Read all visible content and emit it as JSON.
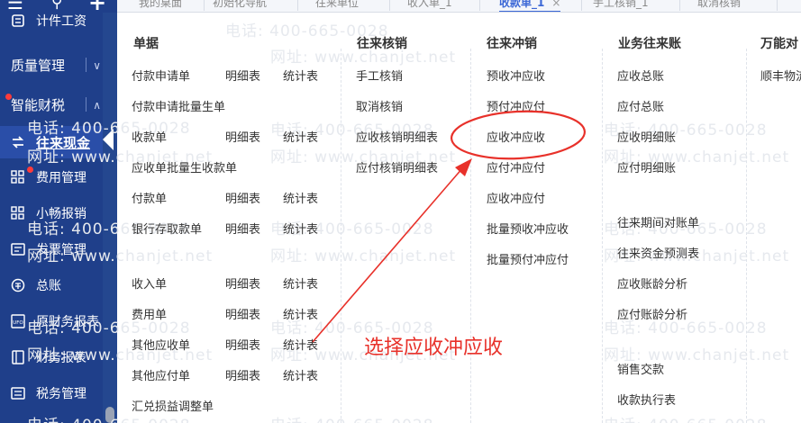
{
  "header": {
    "tabs": [
      {
        "label": "我的桌面"
      },
      {
        "label": "初始化导航"
      },
      {
        "label": "往来单位"
      },
      {
        "label": "收入单_1"
      },
      {
        "label": "收款单_1",
        "active": true
      },
      {
        "label": "手工核销_1"
      },
      {
        "label": "取消核销"
      }
    ],
    "close_glyph": "×"
  },
  "sidebar": {
    "items": [
      {
        "label": "计件工资",
        "icon": "doc-icon"
      },
      {
        "label": "质量管理",
        "icon": "none",
        "group": true,
        "caret": "∨"
      },
      {
        "label": "智能财税",
        "icon": "none",
        "group": true,
        "caret": "∧",
        "badge": true
      },
      {
        "label": "往来现金",
        "icon": "exchange-icon",
        "active": true
      },
      {
        "label": "费用管理",
        "icon": "grid-icon",
        "badge": true
      },
      {
        "label": "小畅报销",
        "icon": "grid-icon"
      },
      {
        "label": "发票管理",
        "icon": "invoice-icon"
      },
      {
        "label": "总账",
        "icon": "ledger-icon"
      },
      {
        "label": "原财务报表",
        "icon": "ufo-icon"
      },
      {
        "label": "财务报表",
        "icon": "report-icon"
      },
      {
        "label": "税务管理",
        "icon": "tax-icon"
      }
    ]
  },
  "columns": {
    "documents": {
      "header": "单据",
      "rows": [
        {
          "main": "付款申请单",
          "detail": "明细表",
          "stats": "统计表"
        },
        {
          "main": "付款申请批量生单"
        },
        {
          "main": "收款单",
          "detail": "明细表",
          "stats": "统计表"
        },
        {
          "main": "应收单批量生收款单"
        },
        {
          "main": "付款单",
          "detail": "明细表",
          "stats": "统计表"
        },
        {
          "main": "银行存取款单",
          "detail": "明细表",
          "stats": "统计表"
        },
        {
          "main": "收入单",
          "detail": "明细表",
          "stats": "统计表"
        },
        {
          "main": "费用单",
          "detail": "明细表",
          "stats": "统计表"
        },
        {
          "main": "其他应收单",
          "detail": "明细表",
          "stats": "统计表"
        },
        {
          "main": "其他应付单",
          "detail": "明细表",
          "stats": "统计表"
        },
        {
          "main": "汇兑损益调整单"
        }
      ]
    },
    "reconcile": {
      "header": "往来核销",
      "items": [
        "手工核销",
        "取消核销",
        "应收核销明细表",
        "应付核销明细表"
      ]
    },
    "offset": {
      "header": "往来冲销",
      "items": [
        "预收冲应收",
        "预付冲应付",
        "应收冲应收",
        "应付冲应付",
        "应收冲应付",
        "批量预收冲应收",
        "批量预付冲应付"
      ]
    },
    "business": {
      "header": "业务往来账",
      "items": [
        "应收总账",
        "应付总账",
        "应收明细账",
        "应付明细账",
        "往来期间对账单",
        "往来资金预测表",
        "应收账龄分析",
        "应付账龄分析",
        "销售交款",
        "收款执行表"
      ]
    },
    "wanneng": {
      "header": "万能对",
      "items": [
        "顺丰物流"
      ]
    }
  },
  "watermark": {
    "phone": "电话: 400-665-0028",
    "site": "网址: www.chanjet.net"
  },
  "annotation": {
    "text": "选择应收冲应收",
    "color": "#e8312a"
  },
  "colors": {
    "sidebar": "#1f3f8a",
    "sidebar_active": "#2a4ea8",
    "tab_active": "#3b67d6",
    "annotation": "#e8312a"
  }
}
